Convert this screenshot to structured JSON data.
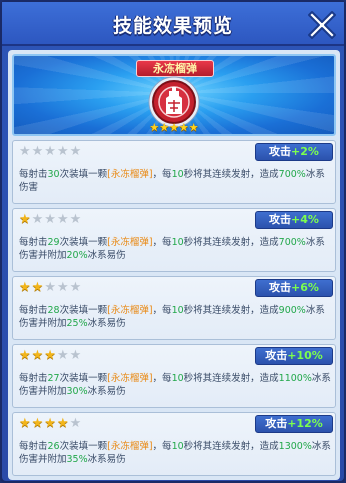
{
  "window": {
    "title": "技能效果预览",
    "close_icon": "close-x-icon"
  },
  "banner": {
    "skill_name": "永冻榴弹",
    "stars": "★★★★★",
    "emblem_icon": "frost-grenade-emblem-icon"
  },
  "colors": {
    "accent": "#2d55b8",
    "star": "#f2b51a",
    "number": "#22a74a",
    "item": "#e98a16",
    "bonus_value": "#7cff4e"
  },
  "levels": [
    {
      "stars_on": "",
      "stars_off": "★★★★★",
      "bonus_label": "攻击",
      "bonus_value": "+2%",
      "p1": "每射击",
      "shots": "30",
      "p2": "次装填一颗",
      "item": "[永冻榴弹]",
      "p3": "，每",
      "secs": "10",
      "p4": "秒将其连续发射，造成",
      "dmg": "700%",
      "p5": "冰系伤害",
      "extra_pre": "",
      "extra_val": "",
      "extra_post": ""
    },
    {
      "stars_on": "★",
      "stars_off": "★★★★",
      "bonus_label": "攻击",
      "bonus_value": "+4%",
      "p1": "每射击",
      "shots": "29",
      "p2": "次装填一颗",
      "item": "[永冻榴弹]",
      "p3": "，每",
      "secs": "10",
      "p4": "秒将其连续发射，造成",
      "dmg": "700%",
      "p5": "冰系伤害并附加",
      "extra_pre": "",
      "extra_val": "20%",
      "extra_post": "冰系易伤"
    },
    {
      "stars_on": "★★",
      "stars_off": "★★★",
      "bonus_label": "攻击",
      "bonus_value": "+6%",
      "p1": "每射击",
      "shots": "28",
      "p2": "次装填一颗",
      "item": "[永冻榴弹]",
      "p3": "，每",
      "secs": "10",
      "p4": "秒将其连续发射，造成",
      "dmg": "900%",
      "p5": "冰系伤害并附加",
      "extra_pre": "",
      "extra_val": "25%",
      "extra_post": "冰系易伤"
    },
    {
      "stars_on": "★★★",
      "stars_off": "★★",
      "bonus_label": "攻击",
      "bonus_value": "+10%",
      "p1": "每射击",
      "shots": "27",
      "p2": "次装填一颗",
      "item": "[永冻榴弹]",
      "p3": "，每",
      "secs": "10",
      "p4": "秒将其连续发射，造成",
      "dmg": "1100%",
      "p5": "冰系伤害并附加",
      "extra_pre": "",
      "extra_val": "30%",
      "extra_post": "冰系易伤"
    },
    {
      "stars_on": "★★★★",
      "stars_off": "★",
      "bonus_label": "攻击",
      "bonus_value": "+12%",
      "p1": "每射击",
      "shots": "26",
      "p2": "次装填一颗",
      "item": "[永冻榴弹]",
      "p3": "，每",
      "secs": "10",
      "p4": "秒将其连续发射，造成",
      "dmg": "1300%",
      "p5": "冰系伤害并附加",
      "extra_pre": "",
      "extra_val": "35%",
      "extra_post": "冰系易伤"
    }
  ]
}
